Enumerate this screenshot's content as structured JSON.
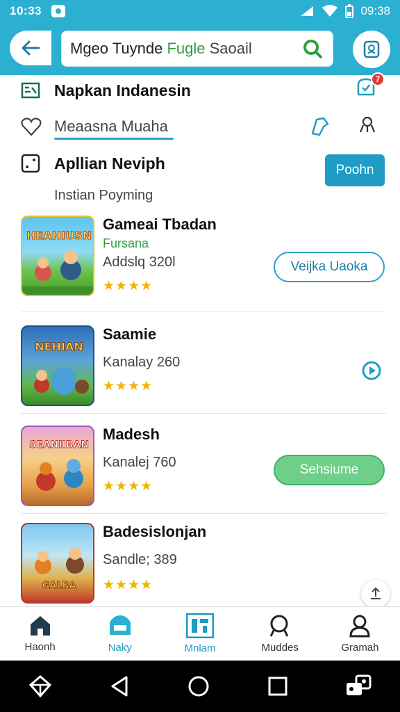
{
  "status_bar": {
    "time": "10:33",
    "right_time": "09:38"
  },
  "search": {
    "prefix": "Mgeo Tuynde ",
    "highlight": "Fugle",
    "rest": " Saoail"
  },
  "menu": [
    {
      "label": "Napkan Indanesin"
    },
    {
      "label": "Meaasna Muaha"
    },
    {
      "label": "Apllian Neviph"
    }
  ],
  "badge_count": "7",
  "primary_button": "Poohn",
  "section_title": "Instian Poyming",
  "list": [
    {
      "title": "Gameai Tbadan",
      "subtitle": "Fursana",
      "meta": "Addslq 320l",
      "rating": "★★★★",
      "action": "Veijka Uaoka",
      "thumb_text": "HEAHIUSN"
    },
    {
      "title": "Saamie",
      "meta": "Kanalay 260",
      "rating": "★★★★",
      "thumb_text": "NEHIAN"
    },
    {
      "title": "Madesh",
      "meta": "Kanalej 760",
      "rating": "★★★★",
      "action": "Sehsiume",
      "thumb_text": "SEANIIBAN"
    },
    {
      "title": "Badesislonjan",
      "meta": "Sandle; 389",
      "rating": "★★★★",
      "thumb_text": "GALBA"
    }
  ],
  "bottom_nav": [
    {
      "label": "Haonh",
      "icon": "home-icon"
    },
    {
      "label": "Naky",
      "icon": "store-icon"
    },
    {
      "label": "Mnlam",
      "icon": "apps-icon"
    },
    {
      "label": "Muddes",
      "icon": "search-icon"
    },
    {
      "label": "Gramah",
      "icon": "profile-icon"
    }
  ],
  "colors": {
    "accent": "#2bb0d2",
    "accent_dark": "#1e9cc4",
    "green": "#3bb36a",
    "star": "#f5b301"
  }
}
